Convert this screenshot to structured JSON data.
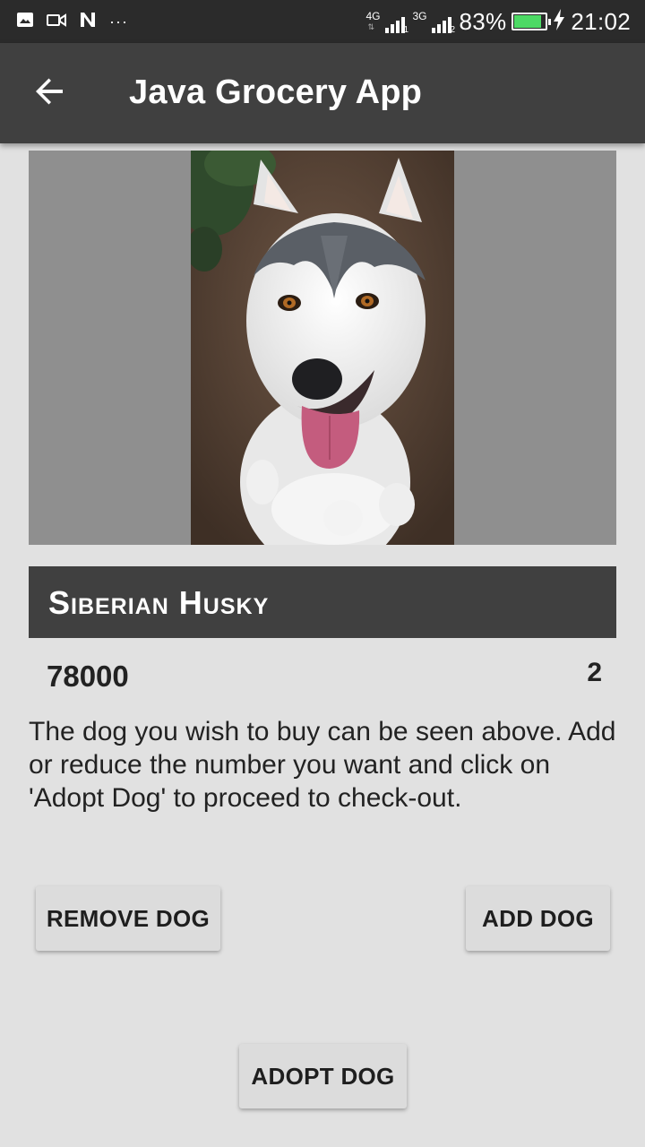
{
  "status_bar": {
    "left_icons": [
      "image-icon",
      "video-icon",
      "n-icon",
      "more-icon"
    ],
    "network_1": "4G",
    "slot_1": "1",
    "network_2": "3G",
    "slot_2": "2",
    "battery_percent": "83%",
    "battery_level": 0.83,
    "time": "21:02"
  },
  "app_bar": {
    "back_icon": "arrow-back-icon",
    "title": "Java Grocery App"
  },
  "product": {
    "image_subject": "husky-photo",
    "name": "Siberian Husky",
    "price": "78000",
    "quantity": "2",
    "description": "The dog you wish to buy can be seen above. Add or reduce the number you want and click on 'Adopt Dog' to proceed to check-out."
  },
  "actions": {
    "remove_label": "REMOVE DOG",
    "add_label": "ADD DOG",
    "adopt_label": "ADOPT DOG"
  },
  "colors": {
    "status_bar": "#2b2b2b",
    "app_bar": "#404040",
    "background": "#e1e1e1",
    "image_frame": "#8f8f8f",
    "battery_fill": "#4cd964"
  }
}
